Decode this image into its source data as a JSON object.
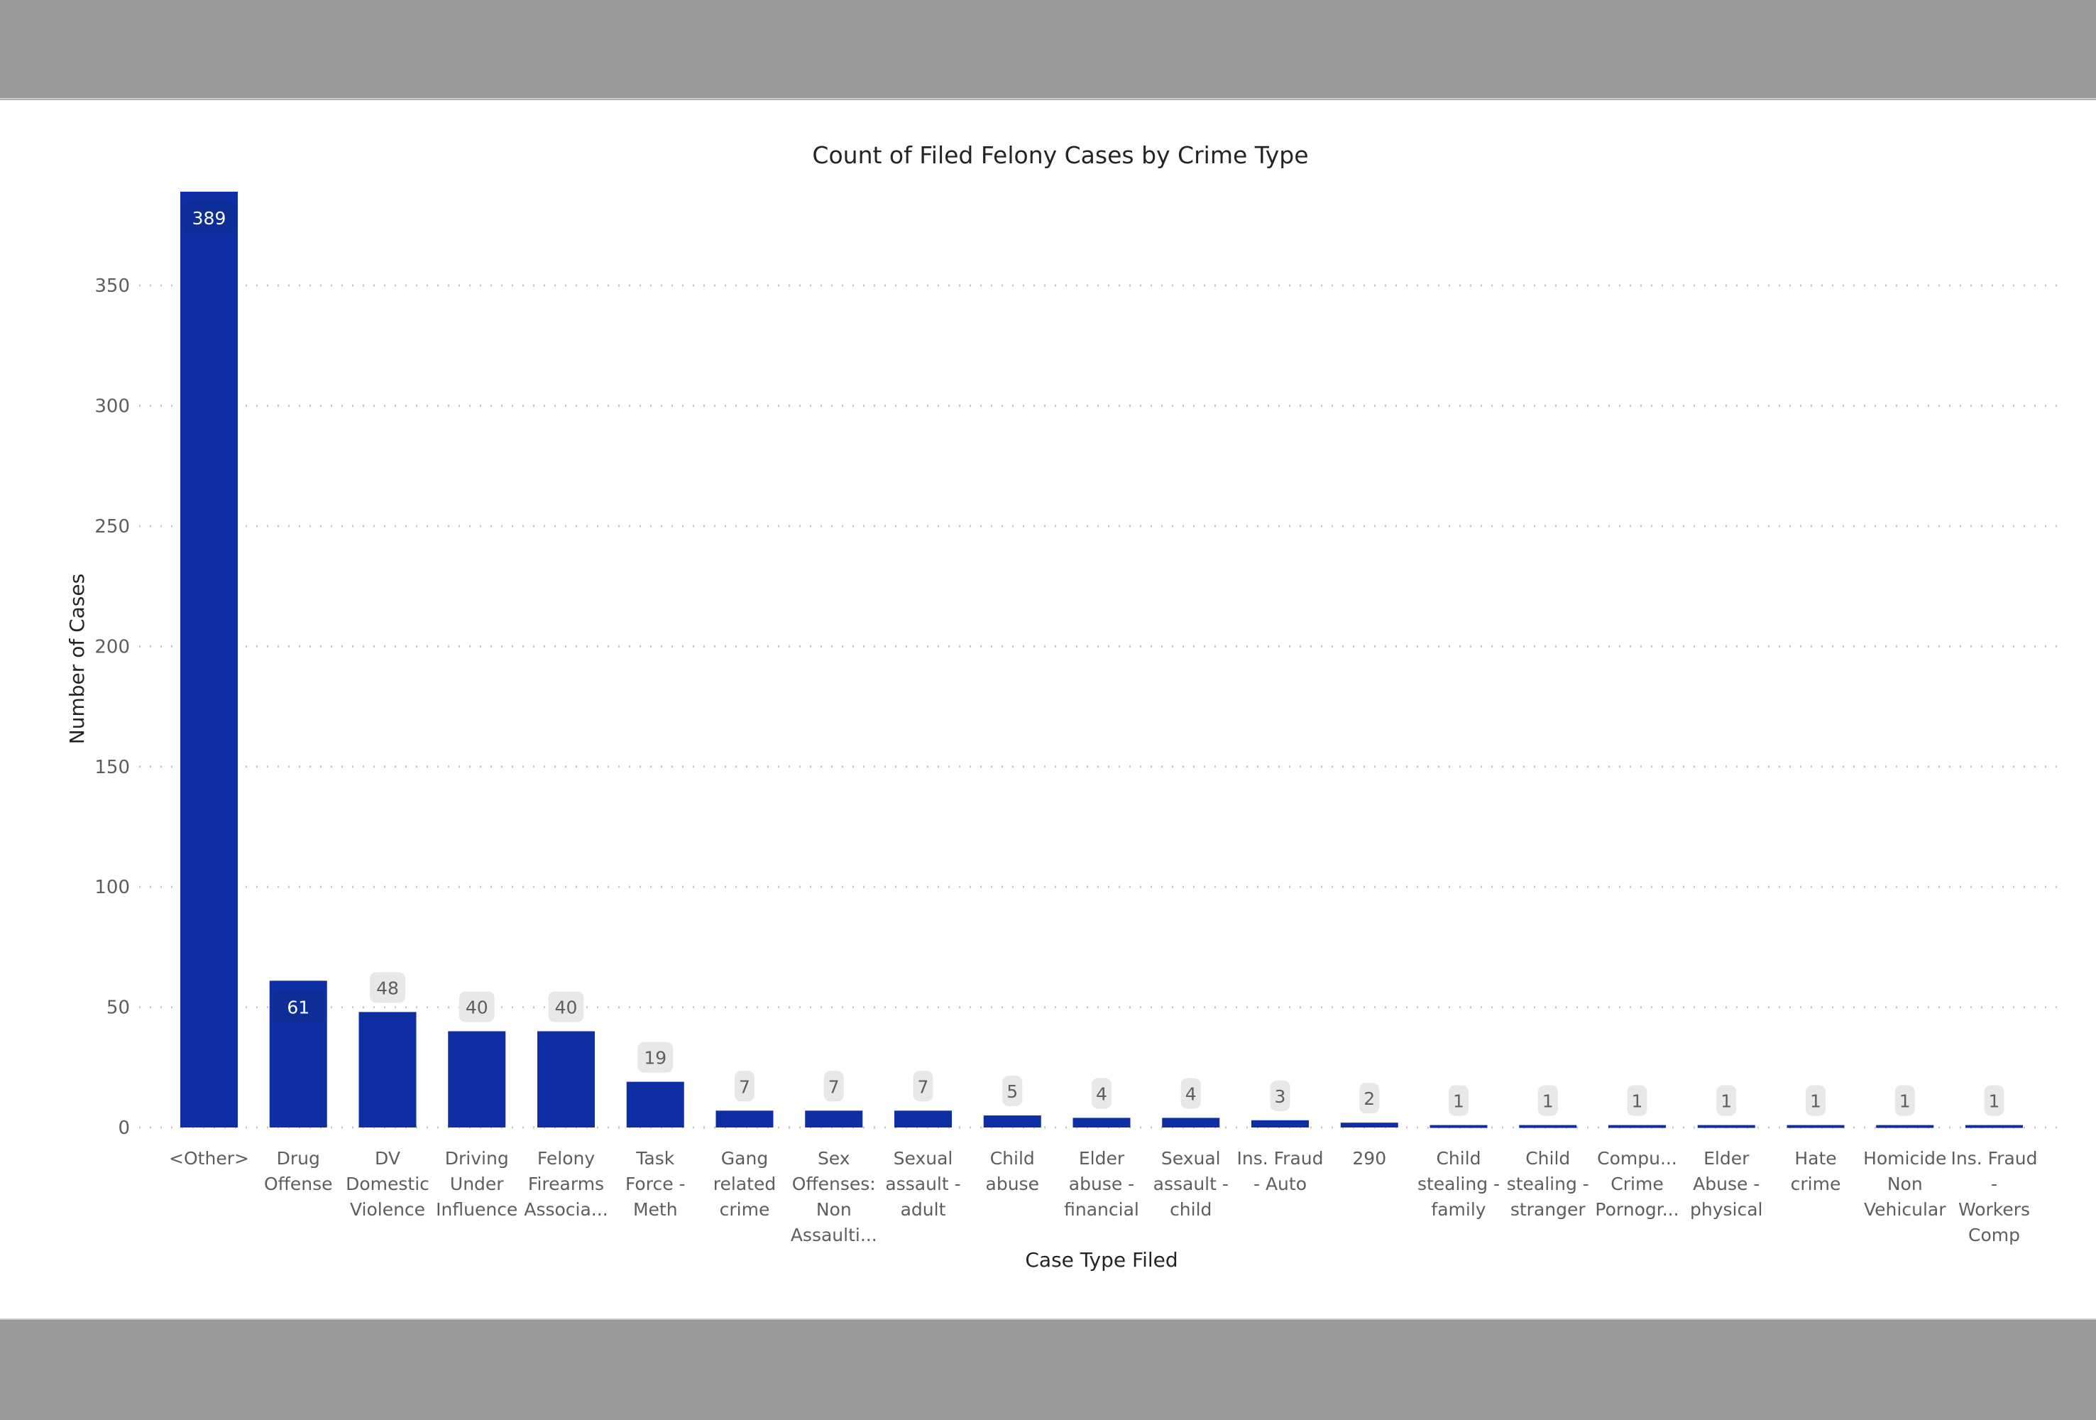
{
  "chart_data": {
    "type": "bar",
    "title": "Count of Filed Felony Cases by Crime Type",
    "xlabel": "Case Type Filed",
    "ylabel": "Number of Cases",
    "ylim": [
      0,
      389
    ],
    "yticks": [
      0,
      50,
      100,
      150,
      200,
      250,
      300,
      350
    ],
    "grid": true,
    "legend": "none",
    "bar_color": "#0d2fa3",
    "label_bg_color": "#e8e8e8",
    "categories": [
      "<Other>",
      "Drug Offense",
      "DV Domestic Violence",
      "Driving Under Influence",
      "Felony Firearms Associa...",
      "Task Force - Meth",
      "Gang related crime",
      "Sex Offenses: Non Assaulti...",
      "Sexual assault - adult",
      "Child abuse",
      "Elder abuse - financial",
      "Sexual assault - child",
      "Ins. Fraud - Auto",
      "290",
      "Child stealing - family",
      "Child stealing - stranger",
      "Compu... Crime Pornogr...",
      "Elder Abuse - physical",
      "Hate crime",
      "Homicide Non Vehicular",
      "Ins. Fraud - Workers Comp"
    ],
    "category_lines": [
      [
        "<Other>"
      ],
      [
        "Drug",
        "Offense"
      ],
      [
        "DV",
        "Domestic",
        "Violence"
      ],
      [
        "Driving",
        "Under",
        "Influence"
      ],
      [
        "Felony",
        "Firearms",
        "Associa..."
      ],
      [
        "Task",
        "Force -",
        "Meth"
      ],
      [
        "Gang",
        "related",
        "crime"
      ],
      [
        "Sex",
        "Offenses:",
        "Non",
        "Assaulti..."
      ],
      [
        "Sexual",
        "assault -",
        "adult"
      ],
      [
        "Child",
        "abuse"
      ],
      [
        "Elder",
        "abuse -",
        "financial"
      ],
      [
        "Sexual",
        "assault -",
        "child"
      ],
      [
        "Ins. Fraud",
        "- Auto"
      ],
      [
        "290"
      ],
      [
        "Child",
        "stealing -",
        "family"
      ],
      [
        "Child",
        "stealing -",
        "stranger"
      ],
      [
        "Compu...",
        "Crime",
        "Pornogr..."
      ],
      [
        "Elder",
        "Abuse -",
        "physical"
      ],
      [
        "Hate",
        "crime"
      ],
      [
        "Homicide",
        "Non",
        "Vehicular"
      ],
      [
        "Ins. Fraud",
        "-",
        "Workers",
        "Comp"
      ]
    ],
    "values": [
      389,
      61,
      48,
      40,
      40,
      19,
      7,
      7,
      7,
      5,
      4,
      4,
      3,
      2,
      1,
      1,
      1,
      1,
      1,
      1,
      1
    ]
  }
}
